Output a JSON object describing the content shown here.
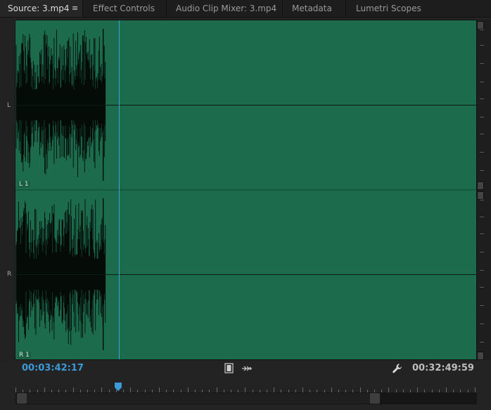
{
  "tabs": [
    {
      "label": "Source: 3.mp4",
      "active": true
    },
    {
      "label": "Effect Controls",
      "active": false
    },
    {
      "label": "Audio Clip Mixer: 3.mp4",
      "active": false
    },
    {
      "label": "Metadata",
      "active": false
    },
    {
      "label": "Lumetri Scopes",
      "active": false
    }
  ],
  "tab_menu_icon": "≡",
  "channels": {
    "left": {
      "side_label": "L",
      "track_label": "L 1"
    },
    "right": {
      "side_label": "R",
      "track_label": "R 1"
    }
  },
  "timecode": {
    "current": "00:03:42:17",
    "duration": "00:32:49:59"
  },
  "controls": {
    "insert_icon": "film-icon",
    "export_icon": "drag-audio-icon",
    "settings_icon": "wrench-icon"
  },
  "colors": {
    "waveform_bg": "#1c6b4c",
    "playhead": "#38a4de",
    "timecode_current": "#3c9ad8"
  }
}
